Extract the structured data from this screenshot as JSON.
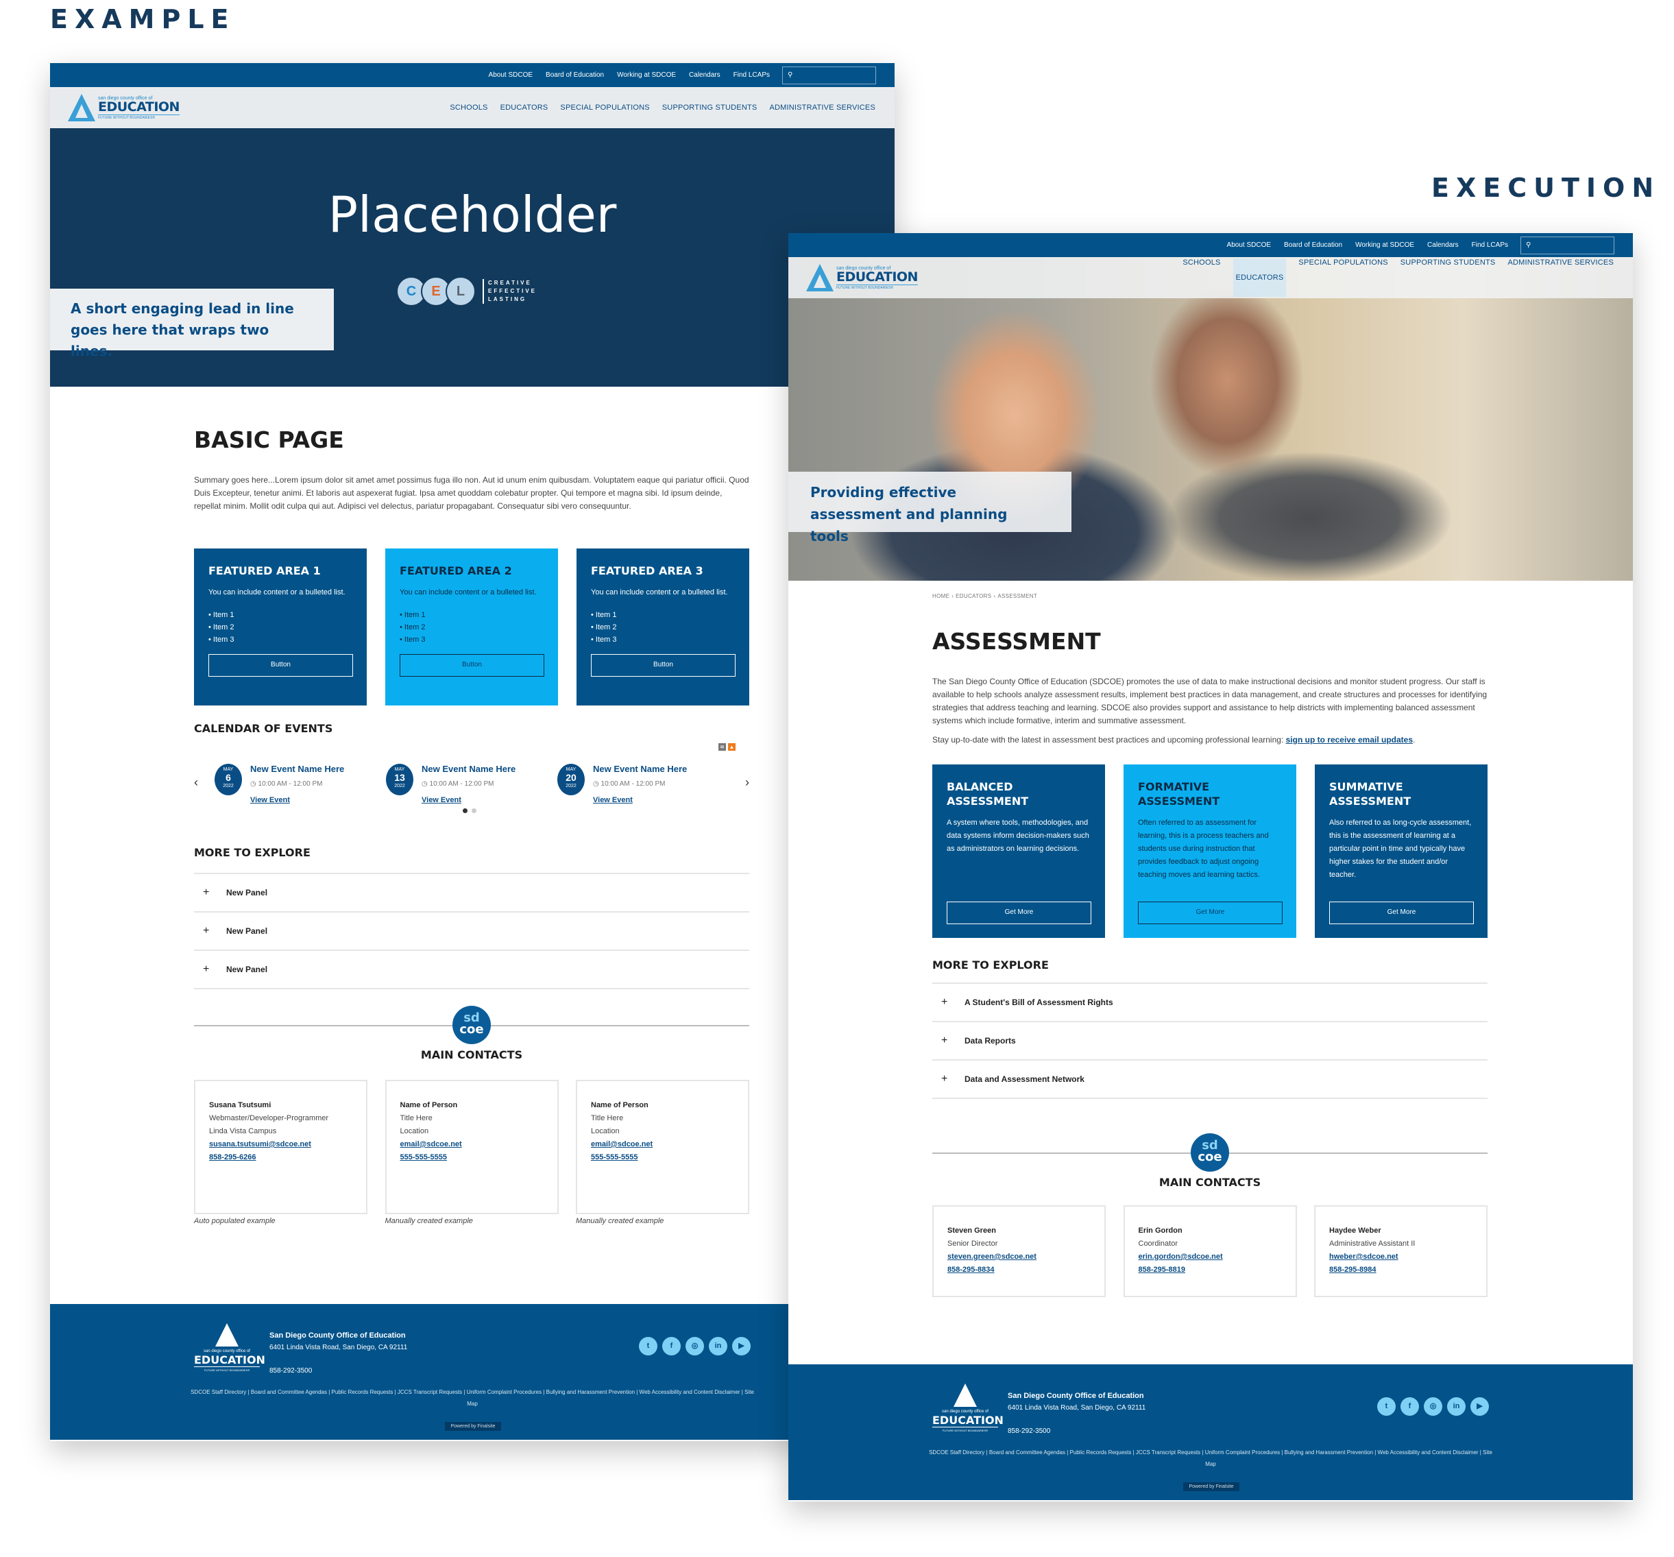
{
  "labels": {
    "example": "EXAMPLE",
    "execution": "EXECUTION"
  },
  "header": {
    "utility_links": [
      "About SDCOE",
      "Board of Education",
      "Working at SDCOE",
      "Calendars",
      "Find LCAPs"
    ],
    "search_icon": "search-icon",
    "logo": {
      "small": "san diego county office of",
      "main": "EDUCATION",
      "tag": "FUTURE WITHOUT BOUNDARIES®"
    },
    "nav": [
      "SCHOOLS",
      "EDUCATORS",
      "SPECIAL POPULATIONS",
      "SUPPORTING STUDENTS",
      "ADMINISTRATIVE SERVICES"
    ]
  },
  "example": {
    "hero_title": "Placeholder",
    "lead": "A short engaging lead in line goes here that wraps two lines.",
    "cel": {
      "letters": [
        "C",
        "E",
        "L"
      ],
      "colors": [
        "#1e86c6",
        "#e0662a",
        "#5a6470"
      ],
      "words": [
        "CREATIVE",
        "EFFECTIVE",
        "LASTING"
      ]
    },
    "page_title": "BASIC PAGE",
    "summary": "Summary goes here...Lorem ipsum dolor sit amet amet possimus fuga illo non. Aut id unum enim quibusdam. Voluptatem eaque qui pariatur officii. Quod Duis Excepteur, tenetur animi. Et laboris aut aspexerat fugiat. Ipsa amet quoddam colebatur propter. Qui tempore et magna sibi. Id ipsum deinde, repellat minim. Mollit odit culpa qui aut. Adipisci vel delectus, pariatur propagabant. Consequatur sibi vero consequuntur.",
    "featured": [
      {
        "title": "FEATURED AREA 1",
        "text": "You can include content or a bulleted list.",
        "items": [
          "Item 1",
          "Item 2",
          "Item 3"
        ],
        "button": "Button",
        "style": "dark"
      },
      {
        "title": "FEATURED AREA 2",
        "text": "You can include content or a bulleted list.",
        "items": [
          "Item 1",
          "Item 2",
          "Item 3"
        ],
        "button": "Button",
        "style": "light"
      },
      {
        "title": "FEATURED AREA 3",
        "text": "You can include content or a bulleted list.",
        "items": [
          "Item 1",
          "Item 2",
          "Item 3"
        ],
        "button": "Button",
        "style": "dark"
      }
    ],
    "calendar_title": "CALENDAR OF EVENTS",
    "events": [
      {
        "month": "MAY",
        "day": "6",
        "year": "2022",
        "name": "New Event Name Here",
        "time": "10:00 AM - 12:00 PM",
        "link": "View Event"
      },
      {
        "month": "MAY",
        "day": "13",
        "year": "2022",
        "name": "New Event Name Here",
        "time": "10:00 AM - 12:00 PM",
        "link": "View Event"
      },
      {
        "month": "MAY",
        "day": "20",
        "year": "2022",
        "name": "New Event Name Here",
        "time": "10:00 AM - 12:00 PM",
        "link": "View Event"
      }
    ],
    "carousel": {
      "prev": "‹",
      "next": "›",
      "pages": 2,
      "active_page": 1
    },
    "explore_title": "MORE TO EXPLORE",
    "panels": [
      "New Panel",
      "New Panel",
      "New Panel"
    ],
    "contacts_title": "MAIN CONTACTS",
    "contacts": [
      {
        "name": "Susana Tsutsumi",
        "lines": [
          "Webmaster/Developer-Programmer",
          "Linda Vista Campus"
        ],
        "email": "susana.tsutsumi@sdcoe.net",
        "phone": "858-295-6266",
        "caption": "Auto populated example"
      },
      {
        "name": "Name of Person",
        "lines": [
          "Title Here",
          "Location"
        ],
        "email": "email@sdcoe.net",
        "phone": "555-555-5555",
        "caption": "Manually created example"
      },
      {
        "name": "Name of Person",
        "lines": [
          "Title Here",
          "Location"
        ],
        "email": "email@sdcoe.net",
        "phone": "555-555-5555",
        "caption": "Manually created example"
      }
    ]
  },
  "execution": {
    "lead": "Providing effective assessment and planning tools",
    "active_nav": "EDUCATORS",
    "breadcrumb": [
      "HOME",
      "EDUCATORS",
      "ASSESSMENT"
    ],
    "page_title": "ASSESSMENT",
    "intro": "The San Diego County Office of Education (SDCOE) promotes the use of data to make instructional decisions and monitor student progress. Our staff is available to help schools analyze assessment results, implement best practices in data management, and create structures and processes for identifying strategies that address teaching and learning. SDCOE also provides support and assistance to help districts with implementing balanced assessment systems which include formative, interim and summative assessment.",
    "signup_prefix": "Stay up-to-date with the latest in assessment best practices and upcoming professional learning: ",
    "signup_link": "sign up to receive email updates",
    "featured": [
      {
        "title": "BALANCED ASSESSMENT",
        "text": "A system where tools, methodologies, and data systems inform decision-makers such as administrators on learning decisions.",
        "button": "Get More",
        "style": "dark"
      },
      {
        "title": "FORMATIVE ASSESSMENT",
        "text": "Often referred to as assessment for learning, this is a process teachers and students use during instruction that provides feedback to adjust ongoing teaching moves and learning tactics.",
        "button": "Get More",
        "style": "light"
      },
      {
        "title": "SUMMATIVE ASSESSMENT",
        "text": "Also referred to as long-cycle assessment, this is the assessment of learning at a particular point in time and typically have higher stakes for the student and/or teacher.",
        "button": "Get More",
        "style": "dark"
      }
    ],
    "explore_title": "MORE TO EXPLORE",
    "panels": [
      "A Student's Bill of Assessment Rights",
      "Data Reports",
      "Data and Assessment Network"
    ],
    "contacts_title": "MAIN CONTACTS",
    "contacts": [
      {
        "name": "Steven Green",
        "lines": [
          "Senior Director"
        ],
        "email": "steven.green@sdcoe.net",
        "phone": "858-295-8834"
      },
      {
        "name": "Erin Gordon",
        "lines": [
          "Coordinator"
        ],
        "email": "erin.gordon@sdcoe.net",
        "phone": "858-295-8819"
      },
      {
        "name": "Haydee Weber",
        "lines": [
          "Administrative Assistant II"
        ],
        "email": "hweber@sdcoe.net",
        "phone": "858-295-8984"
      }
    ]
  },
  "footer": {
    "org": "San Diego County Office of Education",
    "address": "6401 Linda Vista Road, San Diego, CA 92111",
    "phone": "858-292-3500",
    "socials": [
      {
        "name": "twitter",
        "glyph": "t"
      },
      {
        "name": "facebook",
        "glyph": "f"
      },
      {
        "name": "instagram",
        "glyph": "◎"
      },
      {
        "name": "linkedin",
        "glyph": "in"
      },
      {
        "name": "youtube",
        "glyph": "▶"
      }
    ],
    "links": [
      "SDCOE Staff Directory",
      "Board and Committee Agendas",
      "Public Records Requests",
      "JCCS Transcript Requests",
      "Uniform Complaint Procedures",
      "Bullying and Harassment Prevention",
      "Web Accessibility and Content Disclaimer",
      "Site Map"
    ],
    "powered": "Powered by Finalsite"
  },
  "colors": {
    "primary": "#03538a",
    "dark_hero": "#123a5c",
    "accent_light": "#0aaeef",
    "social": "#7fd0f5"
  }
}
